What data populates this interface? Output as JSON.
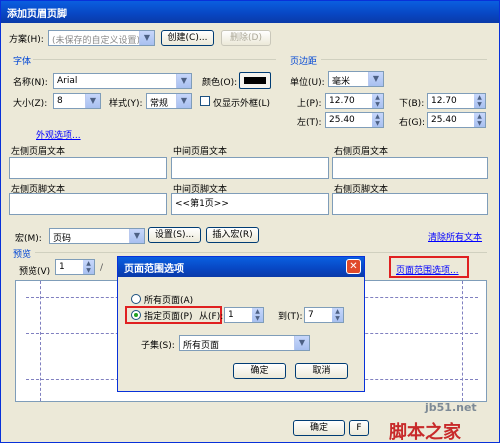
{
  "window": {
    "title": "添加页眉页脚"
  },
  "scheme": {
    "label": "方案(H):",
    "value": "(未保存的自定义设置)",
    "create": "创建(C)...",
    "delete": "删除(D)"
  },
  "font": {
    "group": "字体",
    "name_label": "名称(N):",
    "name_value": "Arial",
    "color_label": "颜色(O):",
    "color": "#000000",
    "size_label": "大小(Z):",
    "size_value": "8",
    "style_label": "样式(Y):",
    "style_value": "常规",
    "outline_only": "仅显示外框(L)"
  },
  "margins": {
    "group": "页边距",
    "unit_label": "单位(U):",
    "unit_value": "毫米",
    "top_label": "上(P):",
    "top_value": "12.70",
    "bottom_label": "下(B):",
    "bottom_value": "12.70",
    "left_label": "左(T):",
    "left_value": "25.40",
    "right_label": "右(G):",
    "right_value": "25.40"
  },
  "appearance_link": "外观选项...",
  "headers": {
    "left": "左侧页眉文本",
    "center": "中间页眉文本",
    "right": "右侧页眉文本"
  },
  "footers": {
    "left": "左侧页脚文本",
    "center": "中间页脚文本",
    "center_value": "<<第1页>>",
    "right": "右侧页脚文本"
  },
  "macro": {
    "label": "宏(M):",
    "value": "页码",
    "settings": "设置(S)...",
    "insert": "插入宏(R)",
    "clear_all": "清除所有文本"
  },
  "preview": {
    "group": "预览",
    "label": "预览(V)",
    "value": "1",
    "page_range_link": "页面范围选项..."
  },
  "dialog": {
    "title": "页面范围选项",
    "all_pages": "所有页面(A)",
    "specified_pages": "指定页面(P)",
    "from_label": "从(F):",
    "from_value": "1",
    "to_label": "到(T):",
    "to_value": "7",
    "subset_label": "子集(S):",
    "subset_value": "所有页面",
    "ok": "确定",
    "cancel": "取消"
  },
  "bottom": {
    "ok": "确定",
    "cancel_partial": "F"
  },
  "watermark": {
    "site": "jb51.net",
    "text": "脚本之家"
  }
}
